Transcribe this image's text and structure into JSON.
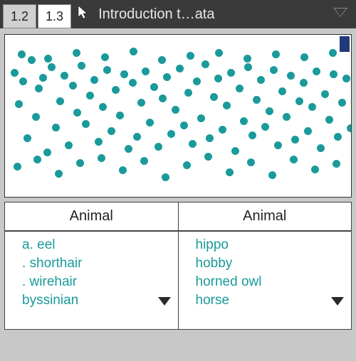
{
  "header": {
    "tabs": [
      {
        "label": "1.2",
        "active": false
      },
      {
        "label": "1.3",
        "active": true
      }
    ],
    "doc_title": "Introduction t…ata"
  },
  "scatter": {
    "color": "#1a9a9a",
    "points": [
      [
        8,
        48
      ],
      [
        14,
        92
      ],
      [
        20,
        60
      ],
      [
        26,
        140
      ],
      [
        32,
        30
      ],
      [
        38,
        110
      ],
      [
        42,
        70
      ],
      [
        48,
        55
      ],
      [
        54,
        160
      ],
      [
        60,
        40
      ],
      [
        66,
        125
      ],
      [
        72,
        88
      ],
      [
        78,
        52
      ],
      [
        84,
        150
      ],
      [
        90,
        66
      ],
      [
        96,
        104
      ],
      [
        102,
        38
      ],
      [
        108,
        120
      ],
      [
        114,
        80
      ],
      [
        120,
        58
      ],
      [
        126,
        145
      ],
      [
        132,
        96
      ],
      [
        138,
        44
      ],
      [
        144,
        130
      ],
      [
        150,
        72
      ],
      [
        156,
        108
      ],
      [
        162,
        50
      ],
      [
        168,
        155
      ],
      [
        174,
        62
      ],
      [
        180,
        138
      ],
      [
        186,
        90
      ],
      [
        192,
        46
      ],
      [
        198,
        118
      ],
      [
        204,
        68
      ],
      [
        210,
        152
      ],
      [
        216,
        84
      ],
      [
        222,
        54
      ],
      [
        228,
        134
      ],
      [
        234,
        100
      ],
      [
        240,
        42
      ],
      [
        246,
        122
      ],
      [
        252,
        76
      ],
      [
        258,
        148
      ],
      [
        264,
        60
      ],
      [
        270,
        112
      ],
      [
        276,
        36
      ],
      [
        282,
        140
      ],
      [
        288,
        82
      ],
      [
        294,
        56
      ],
      [
        300,
        128
      ],
      [
        306,
        94
      ],
      [
        312,
        48
      ],
      [
        318,
        158
      ],
      [
        324,
        70
      ],
      [
        330,
        116
      ],
      [
        336,
        40
      ],
      [
        342,
        136
      ],
      [
        348,
        86
      ],
      [
        354,
        58
      ],
      [
        360,
        124
      ],
      [
        366,
        102
      ],
      [
        372,
        44
      ],
      [
        378,
        150
      ],
      [
        384,
        74
      ],
      [
        390,
        110
      ],
      [
        396,
        52
      ],
      [
        402,
        142
      ],
      [
        408,
        88
      ],
      [
        414,
        62
      ],
      [
        420,
        130
      ],
      [
        426,
        96
      ],
      [
        432,
        46
      ],
      [
        438,
        154
      ],
      [
        444,
        78
      ],
      [
        450,
        114
      ],
      [
        456,
        50
      ],
      [
        462,
        138
      ],
      [
        468,
        90
      ],
      [
        474,
        56
      ],
      [
        480,
        126
      ],
      [
        12,
        180
      ],
      [
        40,
        170
      ],
      [
        70,
        190
      ],
      [
        100,
        175
      ],
      [
        130,
        168
      ],
      [
        160,
        185
      ],
      [
        190,
        172
      ],
      [
        220,
        195
      ],
      [
        250,
        178
      ],
      [
        280,
        166
      ],
      [
        310,
        188
      ],
      [
        340,
        174
      ],
      [
        370,
        192
      ],
      [
        400,
        170
      ],
      [
        430,
        184
      ],
      [
        460,
        176
      ],
      [
        18,
        22
      ],
      [
        55,
        28
      ],
      [
        95,
        20
      ],
      [
        135,
        26
      ],
      [
        175,
        18
      ],
      [
        215,
        30
      ],
      [
        255,
        24
      ],
      [
        295,
        20
      ],
      [
        335,
        28
      ],
      [
        375,
        22
      ],
      [
        415,
        26
      ],
      [
        455,
        20
      ]
    ]
  },
  "tables": {
    "columns": [
      {
        "header": "Animal",
        "rows": [
          "a. eel",
          ". shorthair",
          ". wirehair",
          "byssinian"
        ]
      },
      {
        "header": "Animal",
        "rows": [
          "hippo",
          "hobby",
          "horned owl",
          "horse"
        ]
      }
    ]
  }
}
